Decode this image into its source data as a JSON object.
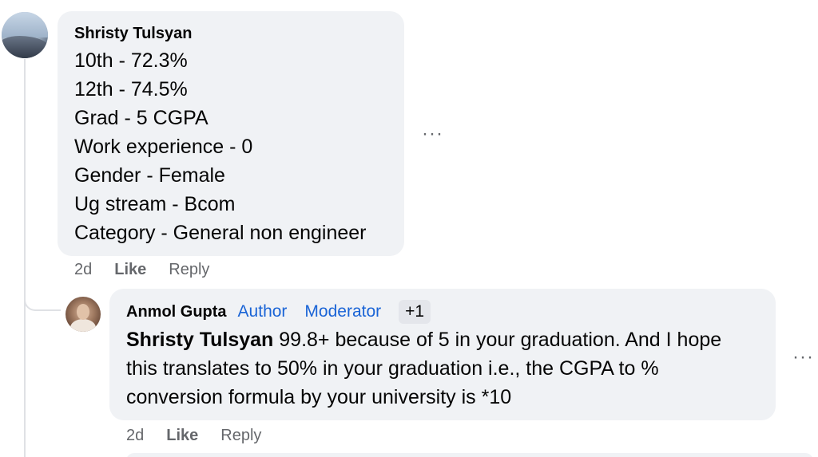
{
  "comment": {
    "author": "Shristy Tulsyan",
    "lines": [
      "10th - 72.3%",
      "12th - 74.5%",
      "Grad - 5 CGPA",
      "Work experience - 0",
      "Gender - Female",
      "Ug stream - Bcom",
      "Category - General non engineer"
    ],
    "more": "···",
    "time": "2d",
    "like": "Like",
    "reply": "Reply"
  },
  "reply": {
    "author": "Anmol Gupta",
    "badges": [
      "Author",
      "Moderator"
    ],
    "extra_badge": "+1",
    "mention": "Shristy Tulsyan",
    "lines": [
      " 99.8+ because of 5 in your graduation. And I hope",
      "this translates to 50% in your graduation i.e., the CGPA to %",
      "conversion formula by your university is *10"
    ],
    "more": "···",
    "time": "2d",
    "like": "Like",
    "reply": "Reply"
  }
}
